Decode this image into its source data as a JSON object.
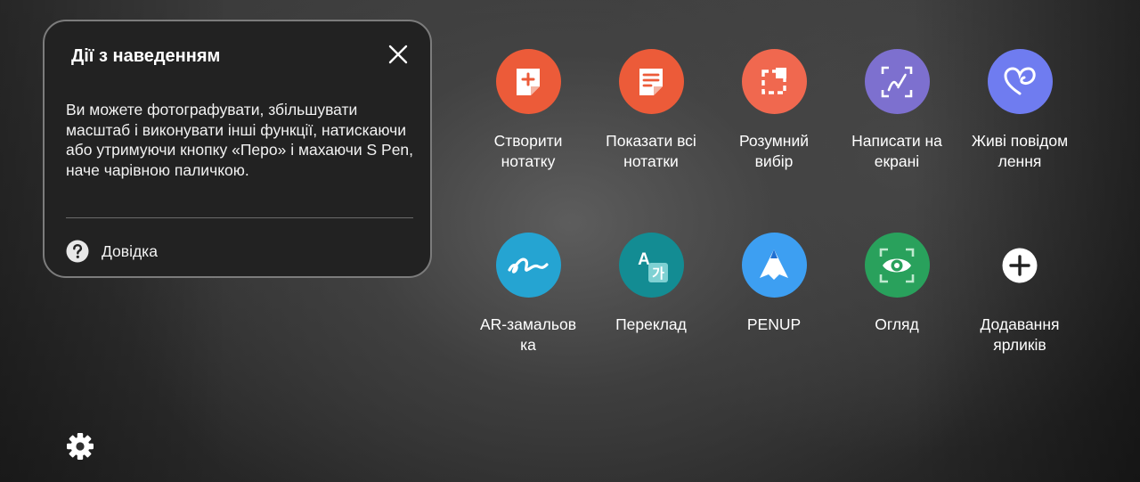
{
  "info_card": {
    "title": "Дії з наведенням",
    "body": "Ви можете фотографувати, збільшувати масштаб і виконувати інші функції, натискаючи або утримуючи кнопку «Перо» і махаючи S Pen, наче чарівною паличкою.",
    "help_label": "Довідка"
  },
  "shortcuts": [
    {
      "label": "Створити\nнотатку",
      "icon": "create-note-icon",
      "color": "#ec5b39"
    },
    {
      "label": "Показати всі\nнотатки",
      "icon": "view-all-notes-icon",
      "color": "#ec5b39"
    },
    {
      "label": "Розумний\nвибір",
      "icon": "smart-select-icon",
      "color": "#f0684f"
    },
    {
      "label": "Написати на\nекрані",
      "icon": "screen-write-icon",
      "color": "#7d70cf"
    },
    {
      "label": "Живі повідом\nлення",
      "icon": "live-messages-icon",
      "color": "#6f7cf0"
    },
    {
      "label": "AR-замальов\nка",
      "icon": "ar-doodle-icon",
      "color": "#25a4d2"
    },
    {
      "label": "Переклад",
      "icon": "translate-icon",
      "color": "#138c93"
    },
    {
      "label": "PENUP",
      "icon": "penup-icon",
      "color": "#3d9ff2"
    },
    {
      "label": "Огляд",
      "icon": "bixby-vision-icon",
      "color": "#29a15c"
    },
    {
      "label": "Додавання\nярликів",
      "icon": "add-icon",
      "color": "#ffffff"
    }
  ]
}
